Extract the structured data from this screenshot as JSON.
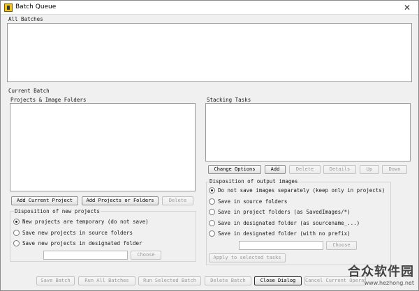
{
  "window": {
    "title": "Batch Queue",
    "close_glyph": "✕"
  },
  "all_batches": {
    "label": "All Batches"
  },
  "current_batch": {
    "label": "Current Batch"
  },
  "projects": {
    "label": "Projects & Image Folders",
    "add_current_project": "Add Current Project",
    "add_projects_or_folders": "Add Projects or Folders",
    "delete": "Delete"
  },
  "new_projects": {
    "label": "Disposition of new projects",
    "options": [
      "New projects are temporary (do not save)",
      "Save new projects in source folders",
      "Save new projects in designated folder"
    ],
    "selected_index": 0,
    "choose": "Choose"
  },
  "stacking_tasks": {
    "label": "Stacking Tasks",
    "change_options": "Change Options",
    "add": "Add",
    "delete": "Delete",
    "details": "Details",
    "up": "Up",
    "down": "Down"
  },
  "output_images": {
    "label": "Disposition of output images",
    "options": [
      "Do not save images separately (keep only in projects)",
      "Save in source folders",
      "Save in project folders (as SavedImages/*)",
      "Save in designated folder (as sourcename_...)",
      "Save in designated folder (with no prefix)"
    ],
    "selected_index": 0,
    "choose": "Choose",
    "apply": "Apply to selected tasks"
  },
  "bottom_bar": {
    "save_batch": "Save Batch",
    "run_all_batches": "Run All Batches",
    "run_selected_batch": "Run Selected Batch",
    "delete_batch": "Delete Batch",
    "close_dialog": "Close Dialog",
    "cancel_current": "Cancel Current Operation"
  },
  "watermark": {
    "brand": "合众软件园",
    "url": "www.hezhong.net"
  }
}
